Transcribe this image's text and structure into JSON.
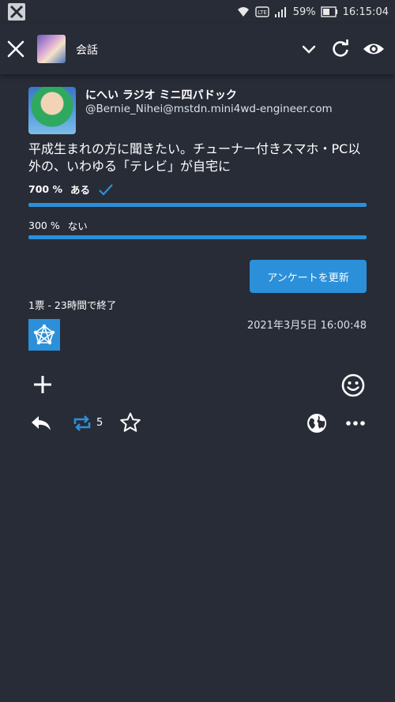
{
  "status_bar": {
    "battery": "59%",
    "time": "16:15:04"
  },
  "app_bar": {
    "title": "会話"
  },
  "post": {
    "display_name": "にへい ラジオ ミニ四パドック",
    "handle": "@Bernie_Nihei@mstdn.mini4wd-engineer.com",
    "content": "平成生まれの方に聞きたい。チューナー付きスマホ・PC以外の、いわゆる「テレビ」が自宅に",
    "poll": {
      "options": [
        {
          "percent": "700 %",
          "label": "ある",
          "voted": true,
          "fill": 1.0
        },
        {
          "percent": "300 %",
          "label": "ない",
          "voted": false,
          "fill": 1.0
        }
      ],
      "refresh_label": "アンケートを更新",
      "meta": "1票 - 23時間で終了"
    },
    "timestamp": "2021年3月5日 16:00:48",
    "reblog_count": "5"
  },
  "colors": {
    "background": "#282c37",
    "accent": "#2b90d9",
    "text": "#ffffff"
  }
}
